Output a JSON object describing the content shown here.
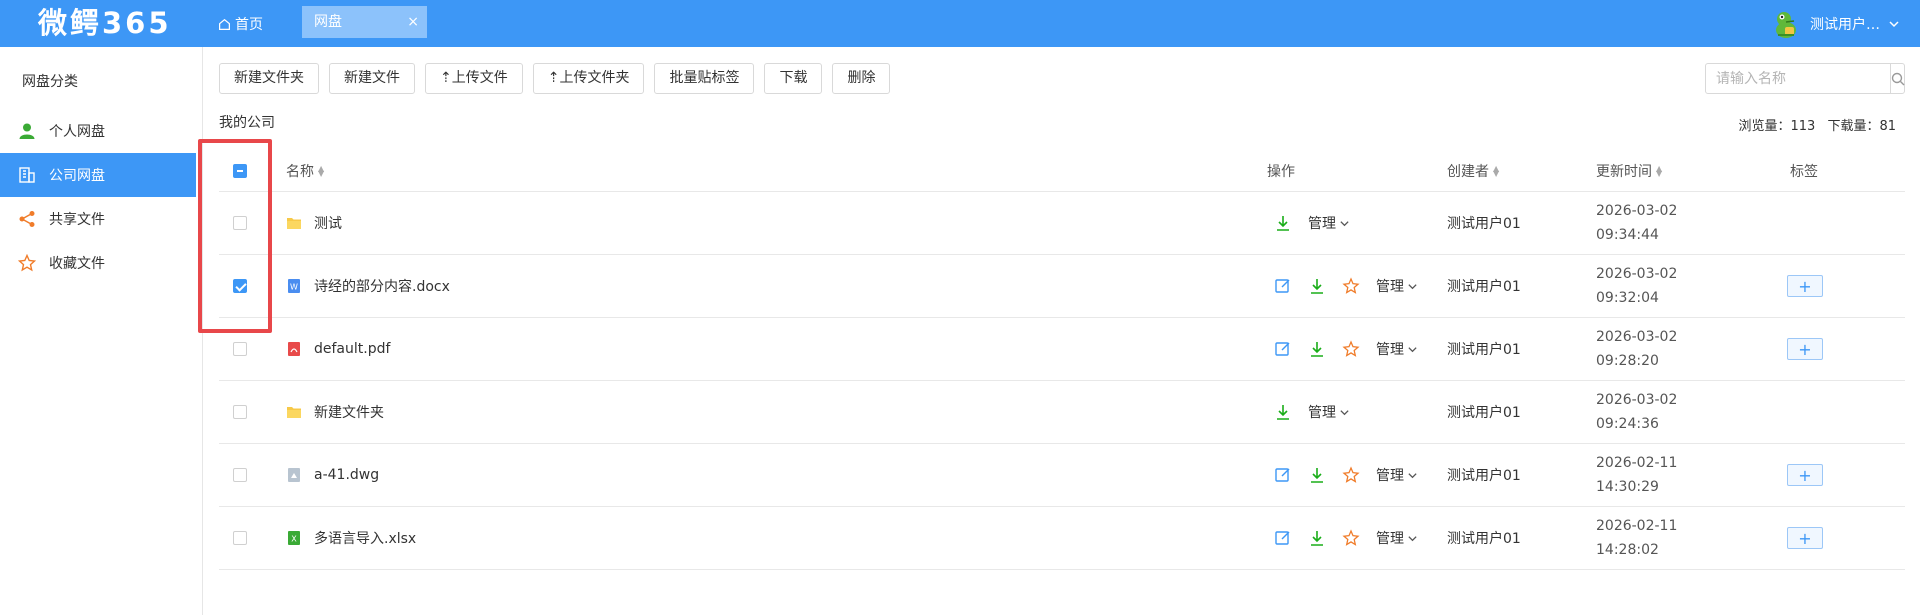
{
  "header": {
    "logo": "微鳄365",
    "home_label": "首页",
    "active_tab": "网盘",
    "tab_close": "×",
    "user_name": "测试用户…"
  },
  "sidebar": {
    "title": "网盘分类",
    "items": [
      {
        "label": "个人网盘",
        "icon": "person-icon"
      },
      {
        "label": "公司网盘",
        "icon": "building-icon",
        "active": true
      },
      {
        "label": "共享文件",
        "icon": "share-icon"
      },
      {
        "label": "收藏文件",
        "icon": "star-icon"
      }
    ]
  },
  "toolbar": {
    "new_folder": "新建文件夹",
    "new_file": "新建文件",
    "upload_file": "上传文件",
    "upload_folder": "上传文件夹",
    "batch_tag": "批量贴标签",
    "download": "下载",
    "delete": "删除"
  },
  "search": {
    "placeholder": "请输入名称"
  },
  "breadcrumb": "我的公司",
  "stats": {
    "views_label": "浏览量：",
    "views": "113",
    "downloads_label": "下载量：",
    "downloads": "81"
  },
  "table": {
    "headers": {
      "name": "名称",
      "ops": "操作",
      "creator": "创建者",
      "updated": "更新时间",
      "tags": "标签"
    },
    "manage_label": "管理",
    "rows": [
      {
        "name": "测试",
        "type": "folder",
        "checked": false,
        "creator": "测试用户01",
        "date": "2026-03-02",
        "time": "09:34:44",
        "can_edit": false,
        "has_tag_btn": false
      },
      {
        "name": "诗经的部分内容.docx",
        "type": "docx",
        "checked": true,
        "creator": "测试用户01",
        "date": "2026-03-02",
        "time": "09:32:04",
        "can_edit": true,
        "has_tag_btn": true
      },
      {
        "name": "default.pdf",
        "type": "pdf",
        "checked": false,
        "creator": "测试用户01",
        "date": "2026-03-02",
        "time": "09:28:20",
        "can_edit": true,
        "has_tag_btn": true
      },
      {
        "name": "新建文件夹",
        "type": "folder",
        "checked": false,
        "creator": "测试用户01",
        "date": "2026-03-02",
        "time": "09:24:36",
        "can_edit": false,
        "has_tag_btn": false
      },
      {
        "name": "a-41.dwg",
        "type": "dwg",
        "checked": false,
        "creator": "测试用户01",
        "date": "2026-02-11",
        "time": "14:30:29",
        "can_edit": true,
        "has_tag_btn": true
      },
      {
        "name": "多语言导入.xlsx",
        "type": "xlsx",
        "checked": false,
        "creator": "测试用户01",
        "date": "2026-02-11",
        "time": "14:28:02",
        "can_edit": true,
        "has_tag_btn": true
      }
    ]
  },
  "colors": {
    "primary": "#3d97f6",
    "highlight": "#e8474a",
    "download": "#1aad19",
    "star": "#f07c2a"
  }
}
